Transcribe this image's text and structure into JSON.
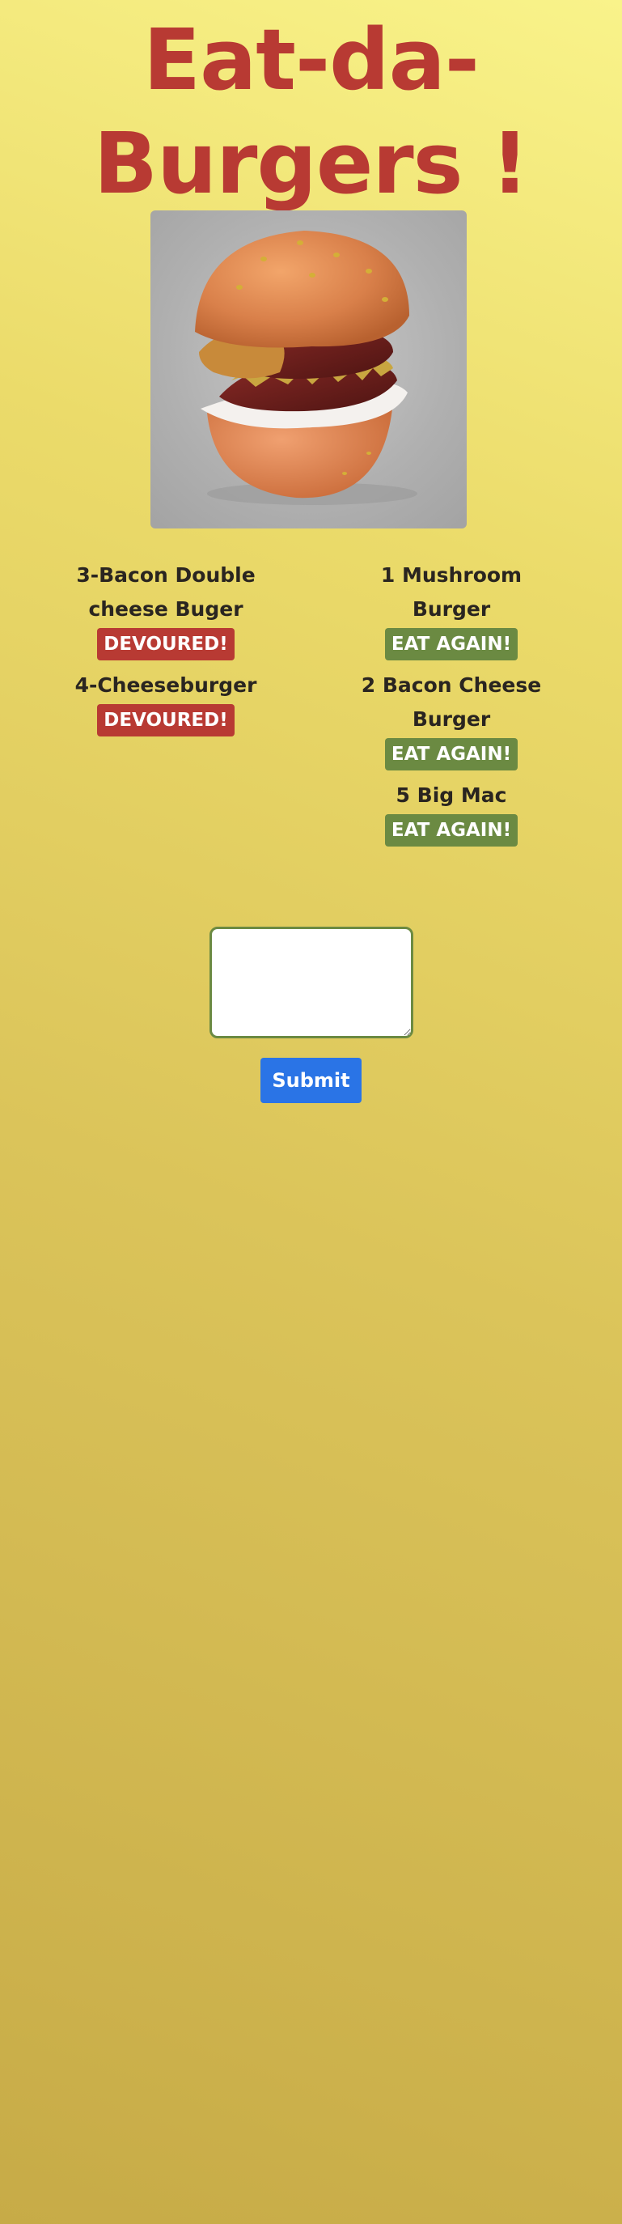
{
  "header": {
    "title": "Eat-da-Burgers !"
  },
  "hero": {
    "image_icon": "burger-image"
  },
  "devoured": [
    {
      "name": "3-Bacon Double cheese Buger",
      "button": "DEVOURED!"
    },
    {
      "name": "4-Cheeseburger",
      "button": "DEVOURED!"
    }
  ],
  "available": [
    {
      "name": "1 Mushroom Burger",
      "button": "EAT AGAIN!"
    },
    {
      "name": "2 Bacon Cheese Burger",
      "button": "EAT AGAIN!"
    },
    {
      "name": "5 Big Mac",
      "button": "EAT AGAIN!"
    }
  ],
  "form": {
    "input_value": "",
    "submit_label": "Submit"
  },
  "colors": {
    "title": "#b83a33",
    "devoured_button": "#b83a33",
    "eat_again_button": "#6b8a42",
    "submit_button": "#2a74e6"
  }
}
